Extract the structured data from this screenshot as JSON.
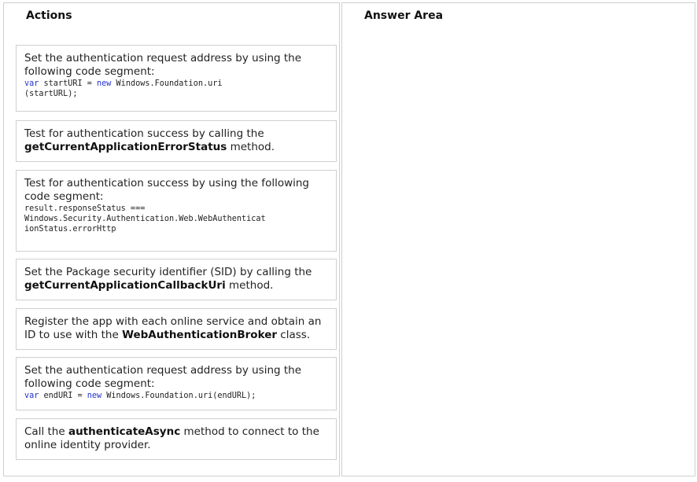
{
  "actions_title": "Actions",
  "answer_title": "Answer Area",
  "items": [
    {
      "text": "Set the authentication request address by using the following code segment:",
      "code_kw1": "var",
      "code_a": " startURI = ",
      "code_kw2": "new",
      "code_b": " Windows.Foundation.uri\n(startURL);"
    },
    {
      "pre": "Test for authentication success by calling the ",
      "bold": "getCurrentApplicationErrorStatus",
      "post": " method."
    },
    {
      "text": "Test for authentication success by using the following code segment:",
      "code": "result.responseStatus ===\nWindows.Security.Authentication.Web.WebAuthenticat\nionStatus.errorHttp"
    },
    {
      "pre": "Set the Package security identifier (SID) by calling the ",
      "bold": "getCurrentApplicationCallbackUri",
      "post": " method."
    },
    {
      "pre": "Register the app with each online service and obtain an ID to use with the ",
      "bold": "WebAuthenticationBroker",
      "post": " class."
    },
    {
      "text": "Set the authentication request address by using the following code segment:",
      "code_kw1": "var",
      "code_a": " endURI = ",
      "code_kw2": "new",
      "code_b": " Windows.Foundation.uri(endURL);"
    },
    {
      "pre": "Call the ",
      "bold": "authenticateAsync",
      "post": " method to connect to the online identity provider."
    }
  ]
}
